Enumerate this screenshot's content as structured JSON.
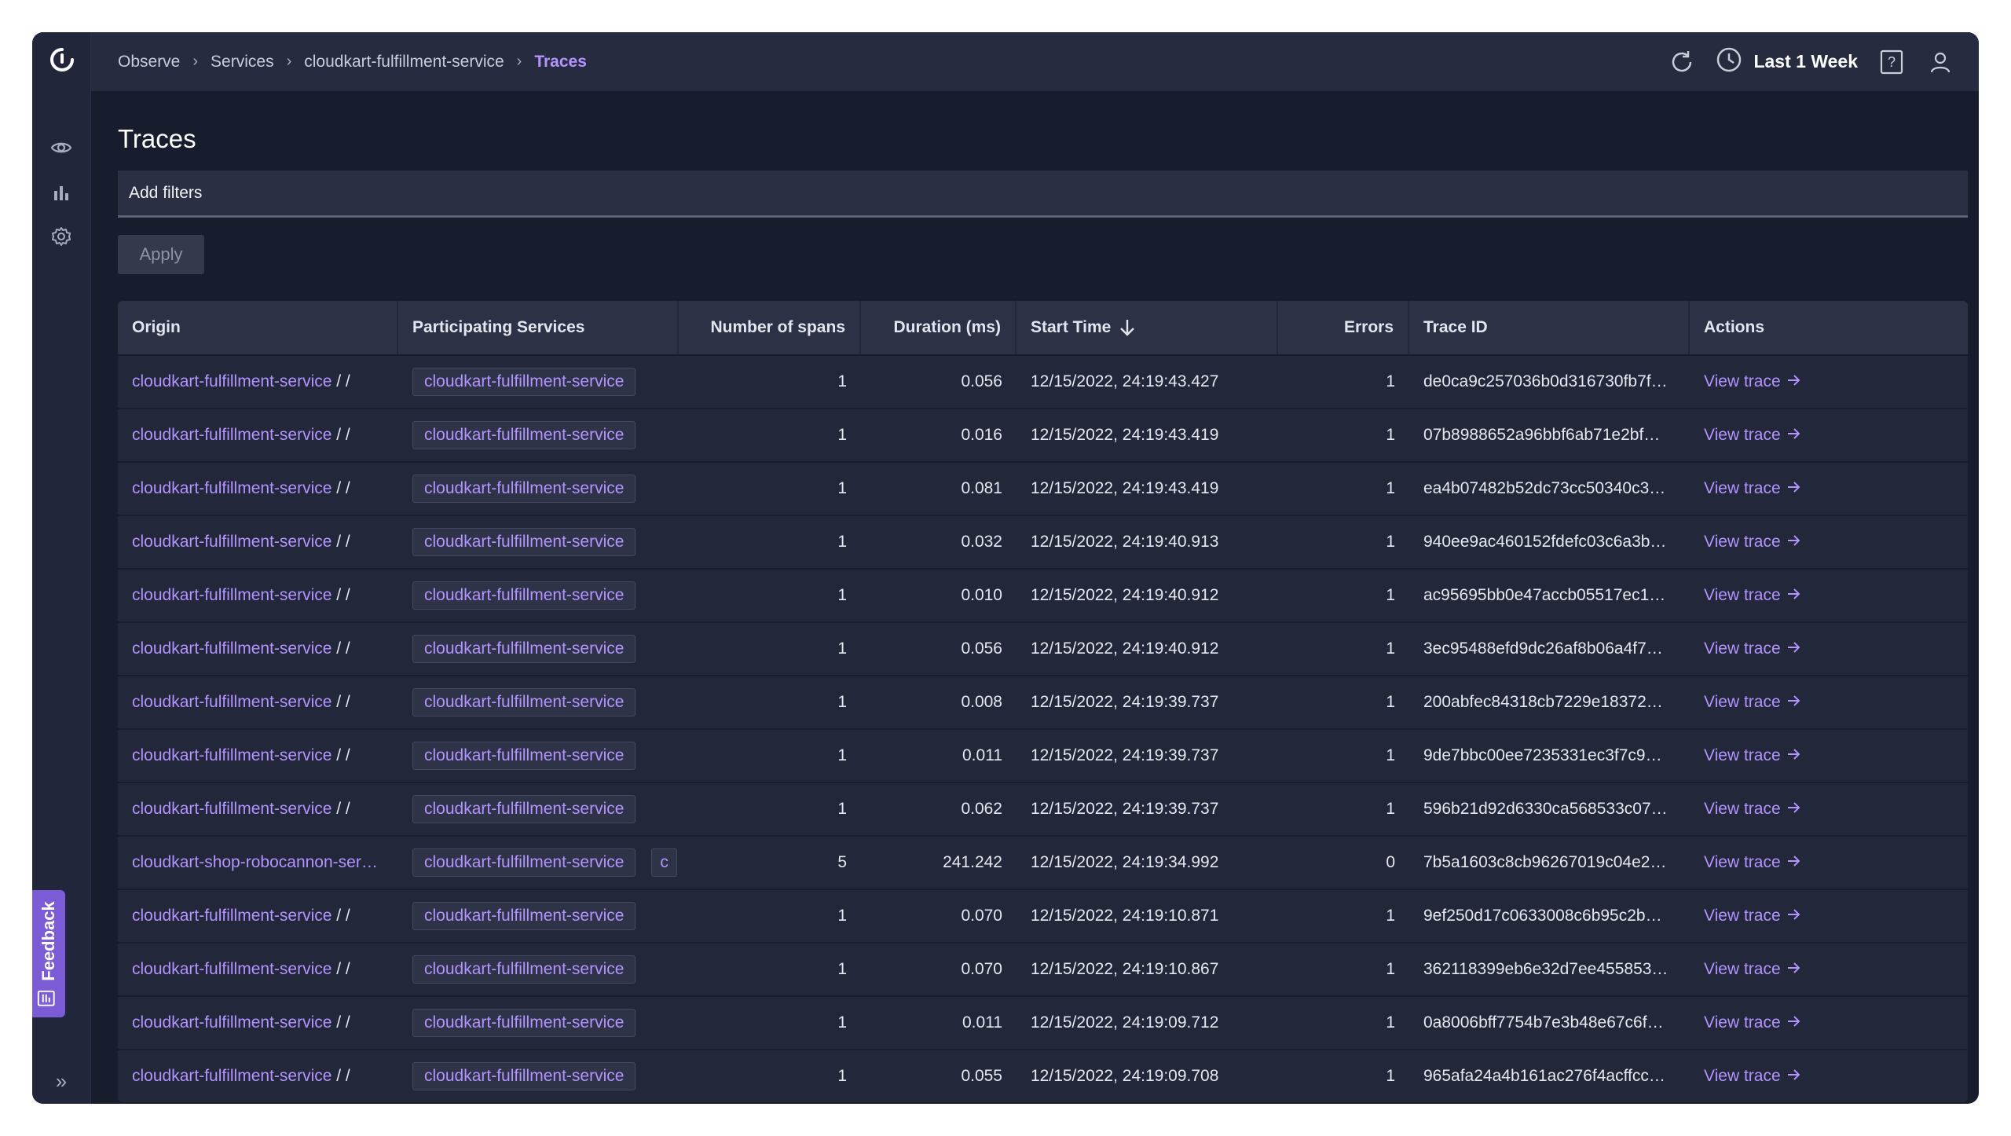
{
  "breadcrumb": {
    "items": [
      "Observe",
      "Services",
      "cloudkart-fulfillment-service",
      "Traces"
    ]
  },
  "topbar": {
    "time_range": "Last 1 Week",
    "icons": [
      "refresh-icon",
      "clock-icon",
      "help-icon",
      "user-icon"
    ]
  },
  "sidebar": {
    "icons": [
      "logo",
      "eye-icon",
      "bar-chart-icon",
      "gear-icon",
      "double-chevron-right-icon"
    ],
    "feedback_label": "Feedback",
    "expand_glyph": "»"
  },
  "page": {
    "title": "Traces",
    "filter_placeholder": "Add filters",
    "apply_label": "Apply"
  },
  "colors": {
    "accent": "#b394ff",
    "feedback": "#7b5bd6",
    "background": "#181d2e"
  },
  "table": {
    "columns": [
      "Origin",
      "Participating Services",
      "Number of spans",
      "Duration (ms)",
      "Start Time",
      "Errors",
      "Trace ID",
      "Actions"
    ],
    "sort": {
      "column": "Start Time",
      "direction": "descending"
    },
    "action_label": "View trace",
    "rows": [
      {
        "origin": "cloudkart-fulfillment-service",
        "suffix": " / /",
        "services": [
          "cloudkart-fulfillment-service"
        ],
        "spans": "1",
        "duration": "0.056",
        "start": "12/15/2022, 24:19:43.427",
        "errors": "1",
        "trace_id": "de0ca9c257036b0d316730fb7f…"
      },
      {
        "origin": "cloudkart-fulfillment-service",
        "suffix": " / /",
        "services": [
          "cloudkart-fulfillment-service"
        ],
        "spans": "1",
        "duration": "0.016",
        "start": "12/15/2022, 24:19:43.419",
        "errors": "1",
        "trace_id": "07b8988652a96bbf6ab71e2bf…"
      },
      {
        "origin": "cloudkart-fulfillment-service",
        "suffix": " / /",
        "services": [
          "cloudkart-fulfillment-service"
        ],
        "spans": "1",
        "duration": "0.081",
        "start": "12/15/2022, 24:19:43.419",
        "errors": "1",
        "trace_id": "ea4b07482b52dc73cc50340c3…"
      },
      {
        "origin": "cloudkart-fulfillment-service",
        "suffix": " / /",
        "services": [
          "cloudkart-fulfillment-service"
        ],
        "spans": "1",
        "duration": "0.032",
        "start": "12/15/2022, 24:19:40.913",
        "errors": "1",
        "trace_id": "940ee9ac460152fdefc03c6a3b…"
      },
      {
        "origin": "cloudkart-fulfillment-service",
        "suffix": " / /",
        "services": [
          "cloudkart-fulfillment-service"
        ],
        "spans": "1",
        "duration": "0.010",
        "start": "12/15/2022, 24:19:40.912",
        "errors": "1",
        "trace_id": "ac95695bb0e47accb05517ec1…"
      },
      {
        "origin": "cloudkart-fulfillment-service",
        "suffix": " / /",
        "services": [
          "cloudkart-fulfillment-service"
        ],
        "spans": "1",
        "duration": "0.056",
        "start": "12/15/2022, 24:19:40.912",
        "errors": "1",
        "trace_id": "3ec95488efd9dc26af8b06a4f7…"
      },
      {
        "origin": "cloudkart-fulfillment-service",
        "suffix": " / /",
        "services": [
          "cloudkart-fulfillment-service"
        ],
        "spans": "1",
        "duration": "0.008",
        "start": "12/15/2022, 24:19:39.737",
        "errors": "1",
        "trace_id": "200abfec84318cb7229e18372…"
      },
      {
        "origin": "cloudkart-fulfillment-service",
        "suffix": " / /",
        "services": [
          "cloudkart-fulfillment-service"
        ],
        "spans": "1",
        "duration": "0.011",
        "start": "12/15/2022, 24:19:39.737",
        "errors": "1",
        "trace_id": "9de7bbc00ee7235331ec3f7c9…"
      },
      {
        "origin": "cloudkart-fulfillment-service",
        "suffix": " / /",
        "services": [
          "cloudkart-fulfillment-service"
        ],
        "spans": "1",
        "duration": "0.062",
        "start": "12/15/2022, 24:19:39.737",
        "errors": "1",
        "trace_id": "596b21d92d6330ca568533c07…"
      },
      {
        "origin": "cloudkart-shop-robocannon-ser…",
        "suffix": "",
        "services": [
          "cloudkart-fulfillment-service",
          "c"
        ],
        "spans": "5",
        "duration": "241.242",
        "start": "12/15/2022, 24:19:34.992",
        "errors": "0",
        "trace_id": "7b5a1603c8cb96267019c04e2…"
      },
      {
        "origin": "cloudkart-fulfillment-service",
        "suffix": " / /",
        "services": [
          "cloudkart-fulfillment-service"
        ],
        "spans": "1",
        "duration": "0.070",
        "start": "12/15/2022, 24:19:10.871",
        "errors": "1",
        "trace_id": "9ef250d17c0633008c6b95c2b…"
      },
      {
        "origin": "cloudkart-fulfillment-service",
        "suffix": " / /",
        "services": [
          "cloudkart-fulfillment-service"
        ],
        "spans": "1",
        "duration": "0.070",
        "start": "12/15/2022, 24:19:10.867",
        "errors": "1",
        "trace_id": "362118399eb6e32d7ee455853…"
      },
      {
        "origin": "cloudkart-fulfillment-service",
        "suffix": " / /",
        "services": [
          "cloudkart-fulfillment-service"
        ],
        "spans": "1",
        "duration": "0.011",
        "start": "12/15/2022, 24:19:09.712",
        "errors": "1",
        "trace_id": "0a8006bff7754b7e3b48e67c6f…"
      },
      {
        "origin": "cloudkart-fulfillment-service",
        "suffix": " / /",
        "services": [
          "cloudkart-fulfillment-service"
        ],
        "spans": "1",
        "duration": "0.055",
        "start": "12/15/2022, 24:19:09.708",
        "errors": "1",
        "trace_id": "965afa24a4b161ac276f4acffcc…"
      }
    ]
  }
}
